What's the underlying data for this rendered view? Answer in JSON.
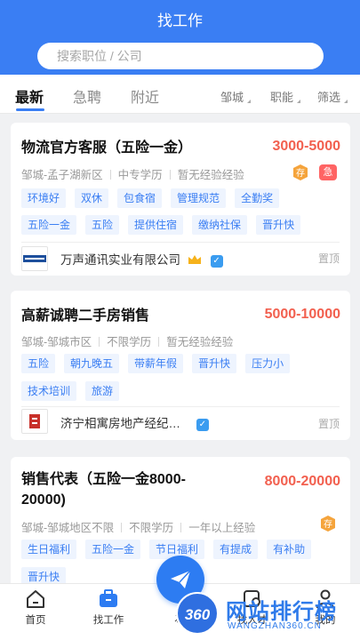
{
  "header": {
    "title": "找工作"
  },
  "search": {
    "placeholder": "搜索职位 / 公司"
  },
  "tabs": [
    {
      "label": "最新",
      "active": true
    },
    {
      "label": "急聘",
      "active": false
    },
    {
      "label": "附近",
      "active": false
    }
  ],
  "filters": [
    {
      "label": "邹城"
    },
    {
      "label": "职能"
    },
    {
      "label": "筛选"
    }
  ],
  "colors": {
    "brand": "#3a7ef3",
    "salary": "#f2604f",
    "tag_bg": "#eef4fe",
    "urgent": "#ff6464",
    "store": "#f5a43c"
  },
  "jobs": [
    {
      "title": "物流官方客服（五险一金）",
      "salary": "3000-5000",
      "meta": [
        "邹城-孟子湖新区",
        "中专学历",
        "暂无经验经验"
      ],
      "badges": [
        "存",
        "急"
      ],
      "tags_row1": [
        "环境好",
        "双休",
        "包食宿",
        "管理规范",
        "全勤奖"
      ],
      "tags_row2": [
        "五险一金",
        "五险",
        "提供住宿",
        "缴纳社保",
        "晋升快"
      ],
      "company": "万声通讯实业有限公司",
      "company_icons": [
        "crown-icon",
        "verified-icon"
      ],
      "pin": "置顶"
    },
    {
      "title": "高薪诚聘二手房销售",
      "salary": "5000-10000",
      "meta": [
        "邹城-邹城市区",
        "不限学历",
        "暂无经验经验"
      ],
      "tags_row1": [
        "五险",
        "朝九晚五",
        "带薪年假",
        "晋升快",
        "压力小"
      ],
      "tags_row2": [
        "技术培训",
        "旅游"
      ],
      "company": "济宁相寓房地产经纪…",
      "company_icons": [
        "verified-icon"
      ],
      "pin": "置顶"
    },
    {
      "title_line1": "销售代表（五险一金8000-",
      "title_line2": "20000)",
      "salary": "8000-20000",
      "meta": [
        "邹城-邹城地区不限",
        "不限学历",
        "一年以上经验"
      ],
      "badges": [
        "存"
      ],
      "tags_row1": [
        "生日福利",
        "五险一金",
        "节日福利",
        "有提成",
        "有补助"
      ],
      "tags_row2": [
        "晋升快"
      ]
    }
  ],
  "bottom_nav": [
    {
      "label": "首页",
      "icon": "home-icon"
    },
    {
      "label": "找工作",
      "icon": "briefcase-icon"
    },
    {
      "label": "发",
      "icon": "send-icon"
    },
    {
      "label": "找人才",
      "icon": "search-person-icon"
    },
    {
      "label": "我的",
      "icon": "user-icon"
    }
  ],
  "watermark": {
    "badge": "360",
    "text": "网站排行榜",
    "sub": "WANGZHAN360.CN"
  }
}
